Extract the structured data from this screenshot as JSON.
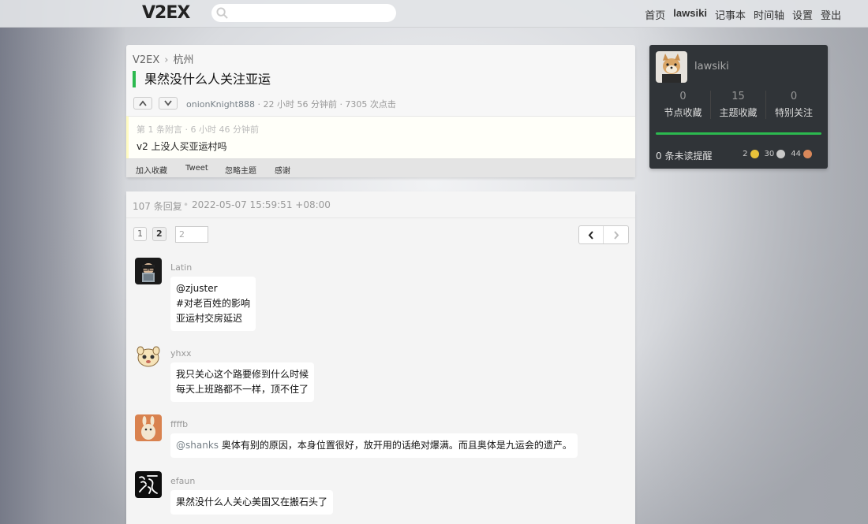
{
  "header": {
    "logo": "V2EX",
    "search_placeholder": "",
    "nav": [
      "首页",
      "lawsiki",
      "记事本",
      "时间轴",
      "设置",
      "登出"
    ]
  },
  "topic": {
    "breadcrumb_home": "V2EX",
    "breadcrumb_node": "杭州",
    "title": "果然没什么人关注亚运",
    "author": "onionKnight888",
    "meta_rest": " · 22 小时 56 分钟前 · 7305 次点击",
    "append_header": "第 1 条附言  ·  6 小时 46 分钟前",
    "append_body": "v2 上没人买亚运村吗",
    "actions": [
      "加入收藏",
      "Tweet",
      "忽略主题",
      "感谢"
    ]
  },
  "replies_header": {
    "count": "107 条回复",
    "sep": "•",
    "datetime": "2022-05-07 15:59:51 +08:00"
  },
  "pagination": {
    "pages": [
      "1",
      "2"
    ],
    "current": "2",
    "input_value": "2"
  },
  "replies": [
    {
      "name": "Latin",
      "lines": [
        "@zjuster",
        "#对老百姓的影响",
        "亚运村交房延迟"
      ]
    },
    {
      "name": "yhxx",
      "lines": [
        "我只关心这个路要修到什么时候",
        "每天上班路都不一样，顶不住了"
      ]
    },
    {
      "name": "ffffb",
      "mention": "@shanks",
      "text": " 奥体有别的原因，本身位置很好，放开用的话绝对爆满。而且奥体是九运会的遗产。"
    },
    {
      "name": "efaun",
      "lines": [
        "果然没什么人关心美国又在搬石头了"
      ]
    }
  ],
  "sidebar": {
    "username": "lawsiki",
    "stats": [
      {
        "num": "0",
        "label": "节点收藏"
      },
      {
        "num": "15",
        "label": "主题收藏"
      },
      {
        "num": "0",
        "label": "特别关注"
      }
    ],
    "notifications": "0 条未读提醒",
    "gold": "2",
    "silver": "30",
    "bronze": "44"
  },
  "colors": {
    "accent_green": "#2cb94f",
    "sidebar_bg": "#303438",
    "gold": "#e8c23a",
    "silver": "#c8c8c8",
    "bronze": "#d9885a"
  }
}
